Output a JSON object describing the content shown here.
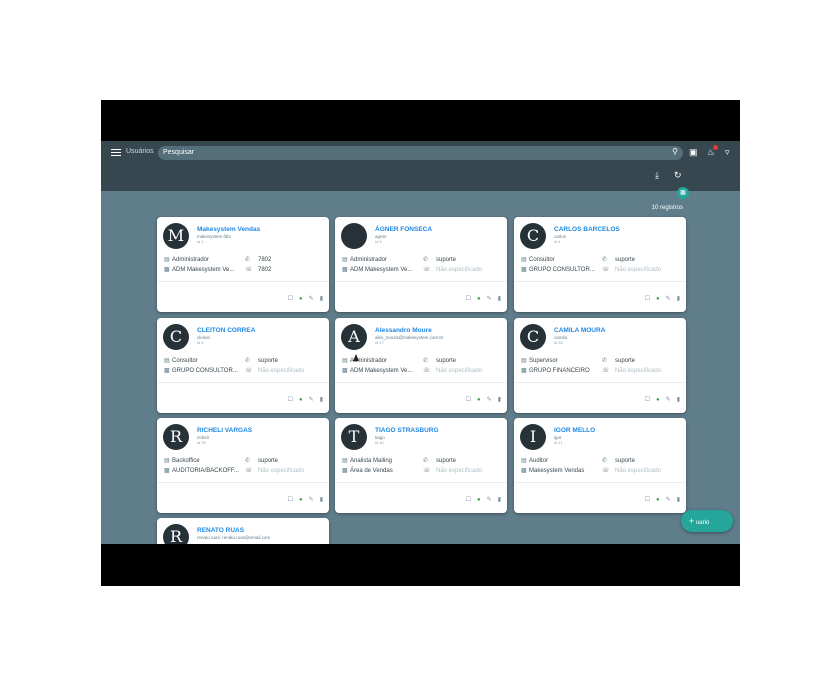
{
  "header": {
    "title": "Usuários",
    "search_placeholder": "Pesquisar"
  },
  "toolbar": {
    "download_icon": "download-icon",
    "refresh_icon": "refresh-icon"
  },
  "records_count": "10 registros",
  "fab": {
    "label": "uario"
  },
  "cards": [
    {
      "initial": "M",
      "name": "Makesystem Vendas",
      "login": "makesystem.fdts",
      "id": "id 1",
      "role": "Administrador",
      "group": "ADM Makesystem Ve...",
      "phone": "7802",
      "line": "7802",
      "line_muted": false
    },
    {
      "initial": "",
      "name": "ÁGNER FONSECA",
      "login": "agner",
      "id": "id 3",
      "role": "Administrador",
      "group": "ADM Makesystem Ve...",
      "phone": "suporte",
      "line": "Não especificado",
      "line_muted": true
    },
    {
      "initial": "C",
      "name": "CARLOS BARCELOS",
      "login": "carlos",
      "id": "id 4",
      "role": "Consultor",
      "group": "GRUPO CONSULTOR...",
      "phone": "suporte",
      "line": "Não especificado",
      "line_muted": true
    },
    {
      "initial": "C",
      "name": "CLEITON CORREA",
      "login": "cleiton",
      "id": "id 5",
      "role": "Consultor",
      "group": "GRUPO CONSULTOR...",
      "phone": "suporte",
      "line": "Não especificado",
      "line_muted": true
    },
    {
      "initial": "A",
      "name": "Alessandro Moure",
      "login": "alex_moura@makesystem.com.br",
      "id": "id 27",
      "role": "Administrador",
      "group": "ADM Makesystem Ve...",
      "phone": "suporte",
      "line": "Não especificado",
      "line_muted": true
    },
    {
      "initial": "C",
      "name": "CAMILA MOURA",
      "login": "camila",
      "id": "id 33",
      "role": "Supervisor",
      "group": "GRUPO FINANCEIRO",
      "phone": "suporte",
      "line": "Não especificado",
      "line_muted": true
    },
    {
      "initial": "R",
      "name": "RICHELI VARGAS",
      "login": "richeli",
      "id": "id 39",
      "role": "Backoffice",
      "group": "AUDITORIA/BACKOFF...",
      "phone": "suporte",
      "line": "Não especificado",
      "line_muted": true
    },
    {
      "initial": "T",
      "name": "TIAGO STRASBURG",
      "login": "tiago",
      "id": "id 40",
      "role": "Analista Mailing",
      "group": "Área de Vendas",
      "phone": "suporte",
      "line": "Não especificado",
      "line_muted": true
    },
    {
      "initial": "I",
      "name": "IGOR MELLO",
      "login": "igor",
      "id": "id 41",
      "role": "Auditor",
      "group": "Makesystem Vendas",
      "phone": "suporte",
      "line": "Não especificado",
      "line_muted": true
    },
    {
      "initial": "R",
      "name": "RENATO RUAS",
      "login": "renato.ruas; renato.ruas@email.com",
      "id": "",
      "role": "",
      "group": "",
      "phone": "",
      "line": "",
      "line_muted": true
    }
  ],
  "colors": {
    "toolbar": "#37474f",
    "background": "#607d8b",
    "accent": "#26a69a",
    "name": "#1e88e5"
  }
}
